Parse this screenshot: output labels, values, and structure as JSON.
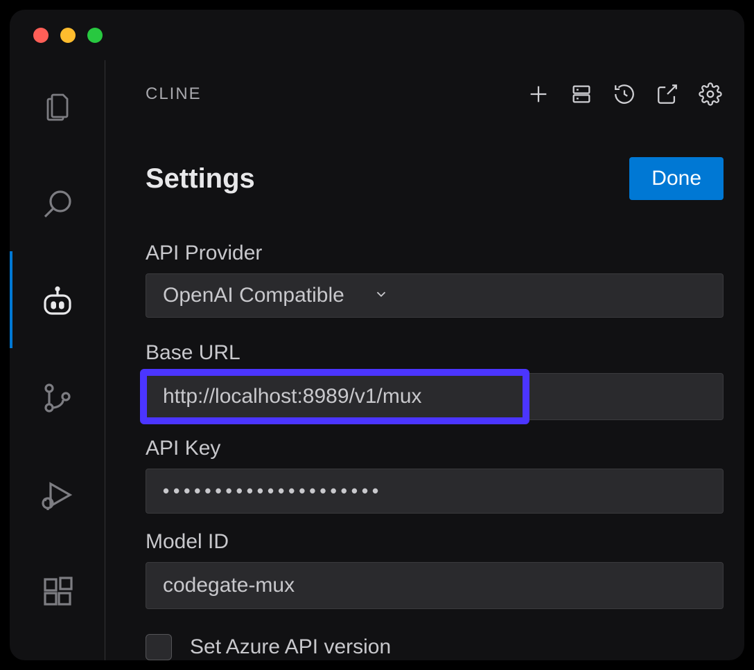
{
  "window": {
    "traffic_lights": [
      "close",
      "minimize",
      "zoom"
    ]
  },
  "activity_bar": {
    "items": [
      {
        "name": "explorer-icon"
      },
      {
        "name": "search-icon"
      },
      {
        "name": "cline-icon",
        "active": true
      },
      {
        "name": "source-control-icon"
      },
      {
        "name": "run-debug-icon"
      },
      {
        "name": "extensions-icon"
      }
    ]
  },
  "header": {
    "title": "CLINE",
    "actions": [
      {
        "name": "new-icon"
      },
      {
        "name": "server-icon"
      },
      {
        "name": "history-icon"
      },
      {
        "name": "open-external-icon"
      },
      {
        "name": "gear-icon"
      }
    ]
  },
  "settings": {
    "title": "Settings",
    "done_label": "Done",
    "api_provider_label": "API Provider",
    "api_provider_value": "OpenAI Compatible",
    "base_url_label": "Base URL",
    "base_url_value": "http://localhost:8989/v1/mux",
    "api_key_label": "API Key",
    "api_key_value": "•••••••••••••••••••••",
    "model_id_label": "Model ID",
    "model_id_value": "codegate-mux",
    "azure_checkbox_label": "Set Azure API version",
    "azure_checkbox_checked": false
  },
  "colors": {
    "accent": "#0078d4",
    "highlight": "#4b35ff"
  }
}
